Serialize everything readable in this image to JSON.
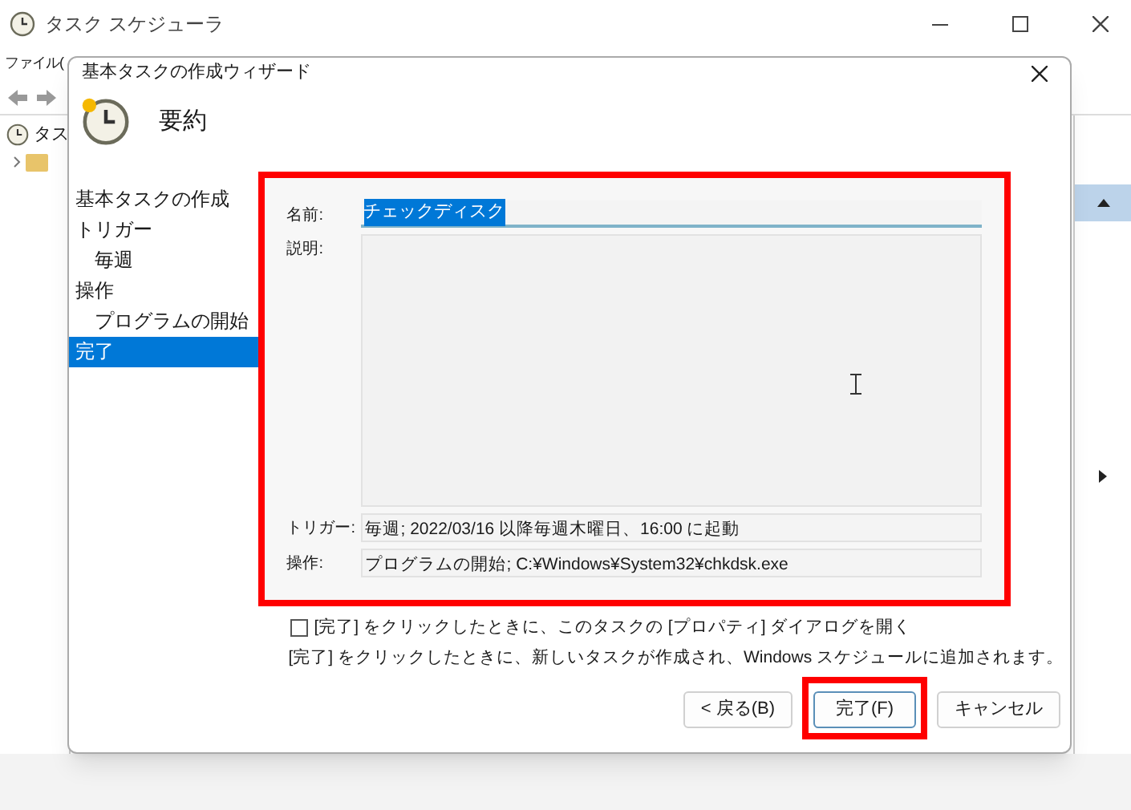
{
  "window": {
    "title": "タスク スケジューラ"
  },
  "menu_bar": {
    "items": [
      "ファイル("
    ]
  },
  "tree": {
    "items": [
      {
        "label": "タス",
        "expanded": true
      }
    ]
  },
  "dialog": {
    "title": "基本タスクの作成ウィザード",
    "header": "要約",
    "steps": [
      {
        "label": "基本タスクの作成",
        "selected": false
      },
      {
        "label": "トリガー",
        "selected": false,
        "children": [
          {
            "label": "毎週",
            "selected": false
          }
        ]
      },
      {
        "label": "操作",
        "selected": false,
        "children": [
          {
            "label": "プログラムの開始",
            "selected": false
          }
        ]
      },
      {
        "label": "完了",
        "selected": true
      }
    ],
    "fields": [
      {
        "label": "名前:",
        "value": "チェックディスク",
        "kind": "name"
      },
      {
        "label": "説明:",
        "kind": "description"
      },
      {
        "label": "トリガー:",
        "value": "毎週; 2022/03/16 以降毎週木曜日、16:00 に起動",
        "kind": "readonly"
      },
      {
        "label": "操作:",
        "value": "プログラムの開始; C:¥Windows¥System32¥chkdsk.exe",
        "kind": "readonly"
      }
    ],
    "open_properties": {
      "label": "[完了] をクリックしたときに、このタスクの [プロパティ] ダイアログを開く",
      "checked": false
    },
    "info": "[完了] をクリックしたときに、新しいタスクが作成され、Windows スケジュールに追加されます。",
    "buttons": [
      {
        "label": "< 戻る(B)",
        "highlighted": false,
        "default": false
      },
      {
        "label": "完了(F)",
        "highlighted": true,
        "default": true
      },
      {
        "label": "キャンセル",
        "highlighted": false,
        "default": false
      }
    ]
  }
}
